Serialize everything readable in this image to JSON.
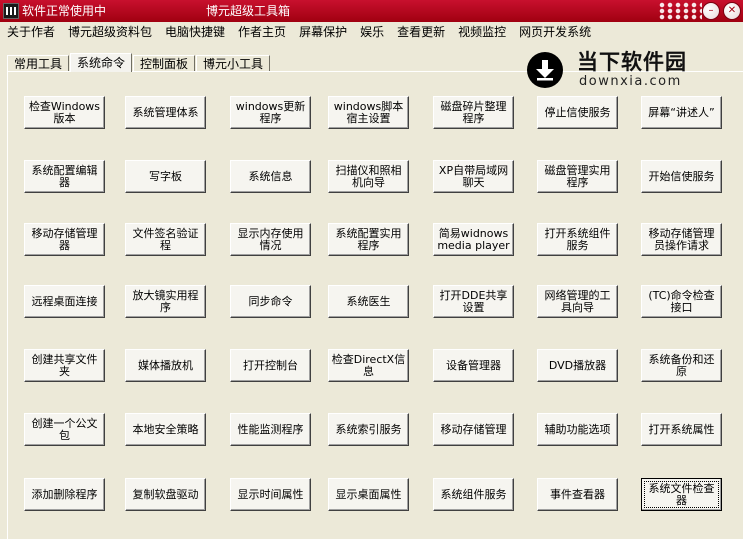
{
  "titlebar": {
    "status_text": "软件正常使用中",
    "window_title": "博元超级工具箱"
  },
  "menu": [
    "关于作者",
    "博元超级资料包",
    "电脑快捷键",
    "作者主页",
    "屏幕保护",
    "娱乐",
    "查看更新",
    "视频监控",
    "网页开发系统"
  ],
  "tabs": [
    {
      "label": "常用工具",
      "active": false
    },
    {
      "label": "系统命令",
      "active": true
    },
    {
      "label": "控制面板",
      "active": false
    },
    {
      "label": "博元小工具",
      "active": false
    }
  ],
  "logo": {
    "title": "当下软件园",
    "url": "downxia.com"
  },
  "buttons": [
    [
      "检查Windows版本",
      "系统管理体系",
      "windows更新程序",
      "windows脚本宿主设置",
      "磁盘碎片整理程序",
      "停止信使服务",
      "屏幕“讲述人”"
    ],
    [
      "系统配置编辑器",
      "写字板",
      "系统信息",
      "扫描仪和照相机向导",
      "XP自带局域网聊天",
      "磁盘管理实用程序",
      "开始信使服务"
    ],
    [
      "移动存储管理器",
      "文件签名验证程",
      "显示内存使用情况",
      "系统配置实用程序",
      "简易widnows media player",
      "打开系统组件服务",
      "移动存储管理员操作请求"
    ],
    [
      "远程桌面连接",
      "放大镜实用程序",
      "同步命令",
      "系统医生",
      "打开DDE共享设置",
      "网络管理的工具向导",
      "(TC)命令检查接口"
    ],
    [
      "创建共享文件夹",
      "媒体播放机",
      "打开控制台",
      "检查DirectX信息",
      "设备管理器",
      "DVD播放器",
      "系统备份和还原"
    ],
    [
      "创建一个公文包",
      "本地安全策略",
      "性能监测程序",
      "系统索引服务",
      "移动存储管理",
      "辅助功能选项",
      "打开系统属性"
    ],
    [
      "添加删除程序",
      "复制软盘驱动",
      "显示时间属性",
      "显示桌面属性",
      "系统组件服务",
      "事件查看器",
      "系统文件检查器"
    ]
  ]
}
